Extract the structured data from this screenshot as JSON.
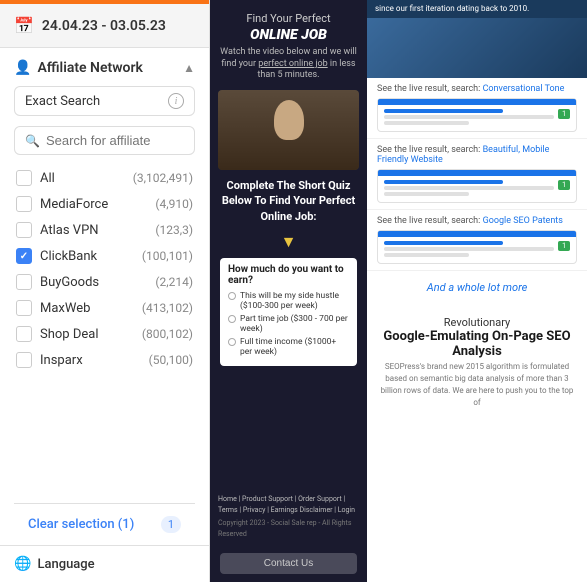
{
  "left_panel": {
    "date_range": "24.04.23 - 03.05.23",
    "affiliate_network_label": "Affiliate Network",
    "exact_search_label": "Exact Search",
    "search_placeholder": "Search for affiliate",
    "items": [
      {
        "name": "All",
        "count": "(3,102,491)",
        "checked": false
      },
      {
        "name": "MediaForce",
        "count": "(4,910)",
        "checked": false
      },
      {
        "name": "Atlas VPN",
        "count": "(123,3)",
        "checked": false
      },
      {
        "name": "ClickBank",
        "count": "(100,101)",
        "checked": true
      },
      {
        "name": "BuyGoods",
        "count": "(2,214)",
        "checked": false
      },
      {
        "name": "MaxWeb",
        "count": "(413,102)",
        "checked": false
      },
      {
        "name": "Shop Deal",
        "count": "(800,102)",
        "checked": false
      },
      {
        "name": "Insparx",
        "count": "(50,100)",
        "checked": false
      }
    ],
    "clear_selection_label": "Clear selection (1)",
    "language_label": "Language"
  },
  "middle_panel": {
    "find_text": "Find Your Perfect",
    "online_job": "ONLINE JOB",
    "watch_text": "Watch the video below and we will find your perfect online job in less than 5 minutes.",
    "complete_text": "Complete The Short Quiz Below To Find Your Perfect Online Job:",
    "quiz_question": "How much do you want to earn?",
    "quiz_options": [
      "This will be my side hustle ($100-300 per week)",
      "Part time job ($300 - 700 per week)",
      "Full time income ($1000+ per week)"
    ],
    "footer_links": "Home | Product Support | Order Support | Terms | Privacy | Earnings Disclaimer | Login",
    "footer_copyright": "Copyright 2023 - Social Sale rep - All Rights Reserved",
    "contact_btn": "Contact Us"
  },
  "right_panel": {
    "banner_text": "since our first iteration dating back to 2010.",
    "result1_label": "See the live result, search: Conversational Tone",
    "result2_label": "See the live result, search: Beautiful, Mobile Friendly Website",
    "result3_label": "See the live result, search: Google SEO Patents",
    "more_label": "And a whole lot more",
    "rev_title": "Revolutionary",
    "rev_subtitle": "Google-Emulating On-Page SEO Analysis",
    "rev_body": "SEOPress's brand new 2015 algorithm is formulated based on semantic big data analysis of more than 3 billion rows of data. We are here to push you to the top of"
  }
}
